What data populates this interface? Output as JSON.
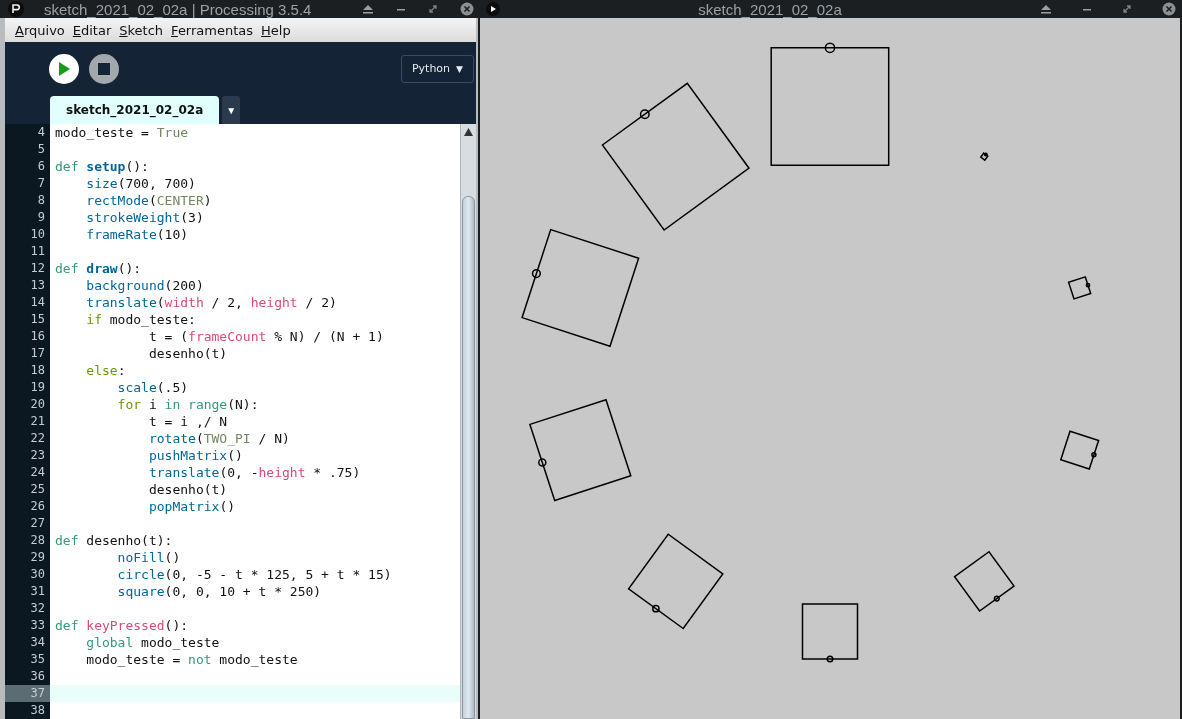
{
  "editor_window": {
    "title": "sketch_2021_02_02a | Processing 3.5.4",
    "menu": [
      "Arquivo",
      "Editar",
      "Sketch",
      "Ferramentas",
      "Help"
    ],
    "mode_selector": {
      "label": "Python",
      "caret": "▼"
    },
    "tabs": [
      {
        "label": "sketch_2021_02_02a",
        "selected": true
      }
    ],
    "tab_menu_caret": "▼",
    "code_lines": [
      {
        "number": "4",
        "current": false,
        "tokens": [
          {
            "text": "modo_teste = ",
            "kind": "plain"
          },
          {
            "text": "True",
            "kind": "constant"
          }
        ]
      },
      {
        "number": "5",
        "current": false
      },
      {
        "number": "6",
        "current": false,
        "tokens": [
          {
            "text": "def",
            "kind": "keyword"
          },
          {
            "text": " setup",
            "kind": "definition"
          },
          {
            "text": "():",
            "kind": "plain"
          }
        ]
      },
      {
        "number": "7",
        "current": false,
        "tokens": [
          {
            "text": "    size",
            "kind": "function"
          },
          {
            "text": "(700, 700)",
            "kind": "plain"
          }
        ]
      },
      {
        "number": "8",
        "current": false,
        "tokens": [
          {
            "text": "    rectMode",
            "kind": "function"
          },
          {
            "text": "(",
            "kind": "plain"
          },
          {
            "text": "CENTER",
            "kind": "constant"
          },
          {
            "text": ")",
            "kind": "plain"
          }
        ]
      },
      {
        "number": "9",
        "current": false,
        "tokens": [
          {
            "text": "    strokeWeight",
            "kind": "function"
          },
          {
            "text": "(3)",
            "kind": "plain"
          }
        ]
      },
      {
        "number": "10",
        "current": false,
        "tokens": [
          {
            "text": "    frameRate",
            "kind": "function"
          },
          {
            "text": "(10)",
            "kind": "plain"
          }
        ]
      },
      {
        "number": "11",
        "current": false
      },
      {
        "number": "12",
        "current": false,
        "tokens": [
          {
            "text": "def",
            "kind": "keyword"
          },
          {
            "text": " draw",
            "kind": "definition"
          },
          {
            "text": "():",
            "kind": "plain"
          }
        ]
      },
      {
        "number": "13",
        "current": false,
        "tokens": [
          {
            "text": "    background",
            "kind": "function"
          },
          {
            "text": "(200)",
            "kind": "plain"
          }
        ]
      },
      {
        "number": "14",
        "current": false,
        "tokens": [
          {
            "text": "    translate",
            "kind": "function"
          },
          {
            "text": "(",
            "kind": "plain"
          },
          {
            "text": "width",
            "kind": "variable"
          },
          {
            "text": " / 2, ",
            "kind": "plain"
          },
          {
            "text": "height",
            "kind": "variable"
          },
          {
            "text": " / 2)",
            "kind": "plain"
          }
        ]
      },
      {
        "number": "15",
        "current": false,
        "tokens": [
          {
            "text": "    if",
            "kind": "control"
          },
          {
            "text": " modo_teste:",
            "kind": "plain"
          }
        ]
      },
      {
        "number": "16",
        "current": false,
        "tokens": [
          {
            "text": "            t = (",
            "kind": "plain"
          },
          {
            "text": "frameCount",
            "kind": "variable"
          },
          {
            "text": " % N) / (N + 1)",
            "kind": "plain"
          }
        ]
      },
      {
        "number": "17",
        "current": false,
        "tokens": [
          {
            "text": "            desenho(t)",
            "kind": "plain"
          }
        ]
      },
      {
        "number": "18",
        "current": false,
        "tokens": [
          {
            "text": "    else",
            "kind": "control"
          },
          {
            "text": ":",
            "kind": "plain"
          }
        ]
      },
      {
        "number": "19",
        "current": false,
        "tokens": [
          {
            "text": "        scale",
            "kind": "function"
          },
          {
            "text": "(.5)",
            "kind": "plain"
          }
        ]
      },
      {
        "number": "20",
        "current": false,
        "tokens": [
          {
            "text": "        for",
            "kind": "control"
          },
          {
            "text": " i ",
            "kind": "plain"
          },
          {
            "text": "in",
            "kind": "keyword"
          },
          {
            "text": " range",
            "kind": "keyword"
          },
          {
            "text": "(N):",
            "kind": "plain"
          }
        ]
      },
      {
        "number": "21",
        "current": false,
        "tokens": [
          {
            "text": "            t = i ,/ N",
            "kind": "plain"
          }
        ]
      },
      {
        "number": "22",
        "current": false,
        "tokens": [
          {
            "text": "            rotate",
            "kind": "function"
          },
          {
            "text": "(",
            "kind": "plain"
          },
          {
            "text": "TWO_PI",
            "kind": "constant"
          },
          {
            "text": " / N)",
            "kind": "plain"
          }
        ]
      },
      {
        "number": "23",
        "current": false,
        "tokens": [
          {
            "text": "            pushMatrix",
            "kind": "function"
          },
          {
            "text": "()",
            "kind": "plain"
          }
        ]
      },
      {
        "number": "24",
        "current": false,
        "tokens": [
          {
            "text": "            translate",
            "kind": "function"
          },
          {
            "text": "(0, -",
            "kind": "plain"
          },
          {
            "text": "height",
            "kind": "variable"
          },
          {
            "text": " * .75)",
            "kind": "plain"
          }
        ]
      },
      {
        "number": "25",
        "current": false,
        "tokens": [
          {
            "text": "            desenho(t)",
            "kind": "plain"
          }
        ]
      },
      {
        "number": "26",
        "current": false,
        "tokens": [
          {
            "text": "            popMatrix",
            "kind": "function"
          },
          {
            "text": "()",
            "kind": "plain"
          }
        ]
      },
      {
        "number": "27",
        "current": false
      },
      {
        "number": "28",
        "current": false,
        "tokens": [
          {
            "text": "def",
            "kind": "keyword"
          },
          {
            "text": " desenho(t):",
            "kind": "plain"
          }
        ]
      },
      {
        "number": "29",
        "current": false,
        "tokens": [
          {
            "text": "        noFill",
            "kind": "function"
          },
          {
            "text": "()",
            "kind": "plain"
          }
        ]
      },
      {
        "number": "30",
        "current": false,
        "tokens": [
          {
            "text": "        circle",
            "kind": "function"
          },
          {
            "text": "(0, -5 - t * 125, 5 + t * 15)",
            "kind": "plain"
          }
        ]
      },
      {
        "number": "31",
        "current": false,
        "tokens": [
          {
            "text": "        square",
            "kind": "function"
          },
          {
            "text": "(0, 0, 10 + t * 250)",
            "kind": "plain"
          }
        ]
      },
      {
        "number": "32",
        "current": false
      },
      {
        "number": "33",
        "current": false,
        "tokens": [
          {
            "text": "def",
            "kind": "keyword"
          },
          {
            "text": " keyPressed",
            "kind": "variable"
          },
          {
            "text": "():",
            "kind": "plain"
          }
        ]
      },
      {
        "number": "34",
        "current": false,
        "tokens": [
          {
            "text": "    global",
            "kind": "keyword"
          },
          {
            "text": " modo_teste",
            "kind": "plain"
          }
        ]
      },
      {
        "number": "35",
        "current": false,
        "tokens": [
          {
            "text": "    modo_teste = ",
            "kind": "plain"
          },
          {
            "text": "not",
            "kind": "keyword"
          },
          {
            "text": " modo_teste",
            "kind": "plain"
          }
        ]
      },
      {
        "number": "36",
        "current": false
      },
      {
        "number": "37",
        "current": true
      },
      {
        "number": "38",
        "current": false
      }
    ]
  },
  "sketch_window": {
    "title": "sketch_2021_02_02a"
  }
}
